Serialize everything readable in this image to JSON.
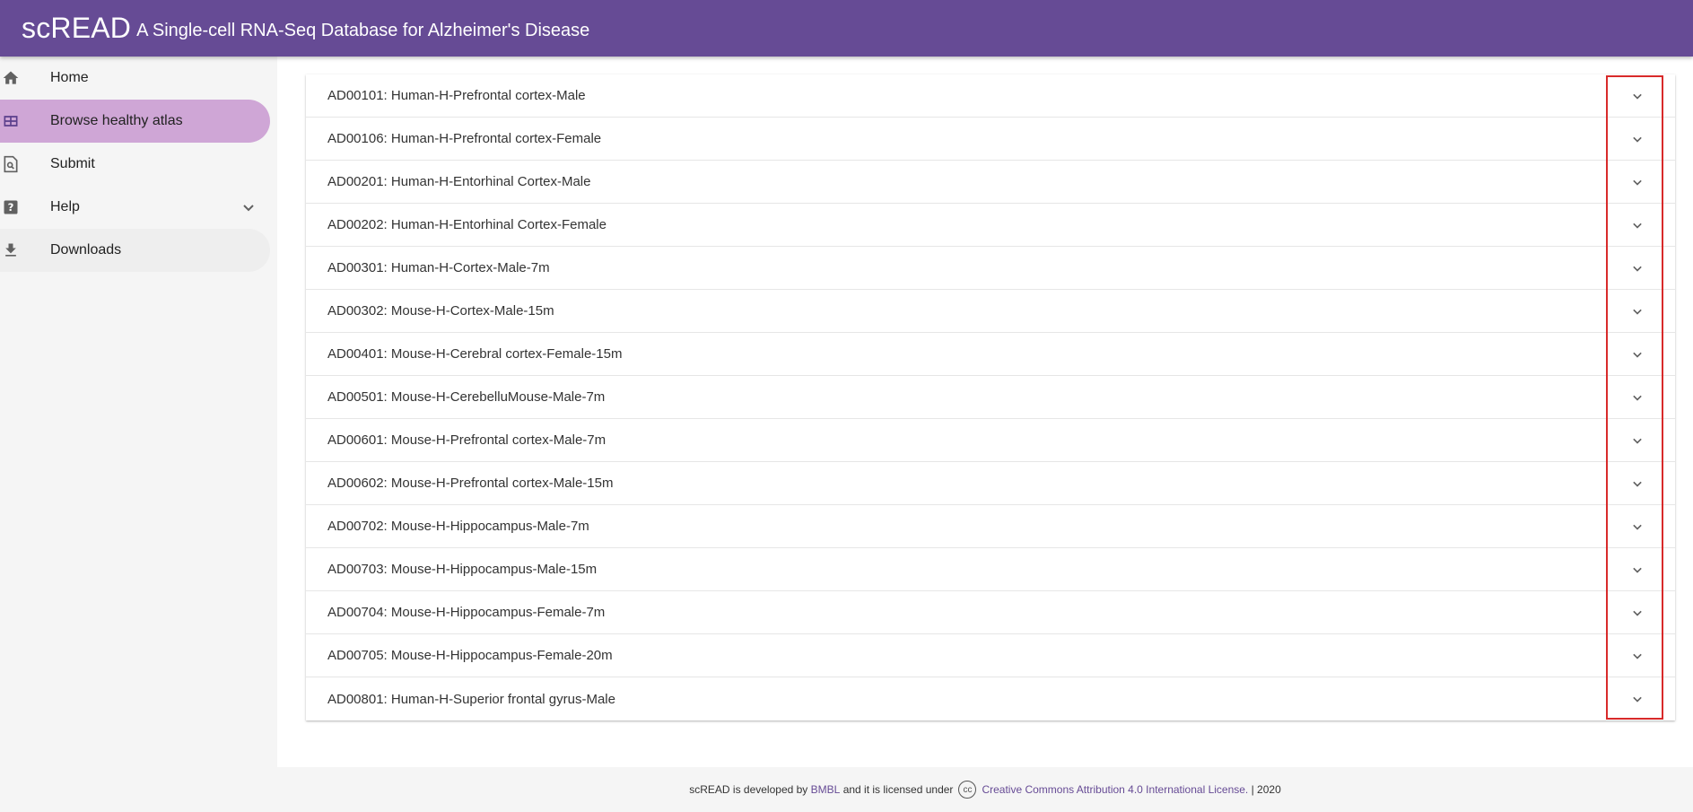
{
  "header": {
    "brand": "scREAD",
    "tagline": "A Single-cell RNA-Seq Database for Alzheimer's Disease"
  },
  "sidebar": {
    "items": [
      {
        "label": "Home",
        "icon": "home-icon"
      },
      {
        "label": "Browse healthy atlas",
        "icon": "table-icon",
        "active": true
      },
      {
        "label": "Submit",
        "icon": "search-document-icon"
      },
      {
        "label": "Help",
        "icon": "help-icon",
        "expandable": true
      },
      {
        "label": "Downloads",
        "icon": "download-icon"
      }
    ]
  },
  "datasets": [
    "AD00101: Human-H-Prefrontal cortex-Male",
    "AD00106: Human-H-Prefrontal cortex-Female",
    "AD00201: Human-H-Entorhinal Cortex-Male",
    "AD00202: Human-H-Entorhinal Cortex-Female",
    "AD00301: Human-H-Cortex-Male-7m",
    "AD00302: Mouse-H-Cortex-Male-15m",
    "AD00401: Mouse-H-Cerebral cortex-Female-15m",
    "AD00501: Mouse-H-CerebelluMouse-Male-7m",
    "AD00601: Mouse-H-Prefrontal cortex-Male-7m",
    "AD00602: Mouse-H-Prefrontal cortex-Male-15m",
    "AD00702: Mouse-H-Hippocampus-Male-7m",
    "AD00703: Mouse-H-Hippocampus-Male-15m",
    "AD00704: Mouse-H-Hippocampus-Female-7m",
    "AD00705: Mouse-H-Hippocampus-Female-20m",
    "AD00801: Human-H-Superior frontal gyrus-Male"
  ],
  "footer": {
    "prefix": "scREAD is developed by",
    "org_link": "BMBL",
    "middle": "and it is licensed under",
    "cc_badge": "cc",
    "license_link": "Creative Commons Attribution 4.0 International License.",
    "suffix": "| 2020"
  },
  "colors": {
    "appbar": "#664b95",
    "active_nav": "#cfa6d6",
    "link": "#664b95",
    "highlight_box": "#d82a2a"
  }
}
